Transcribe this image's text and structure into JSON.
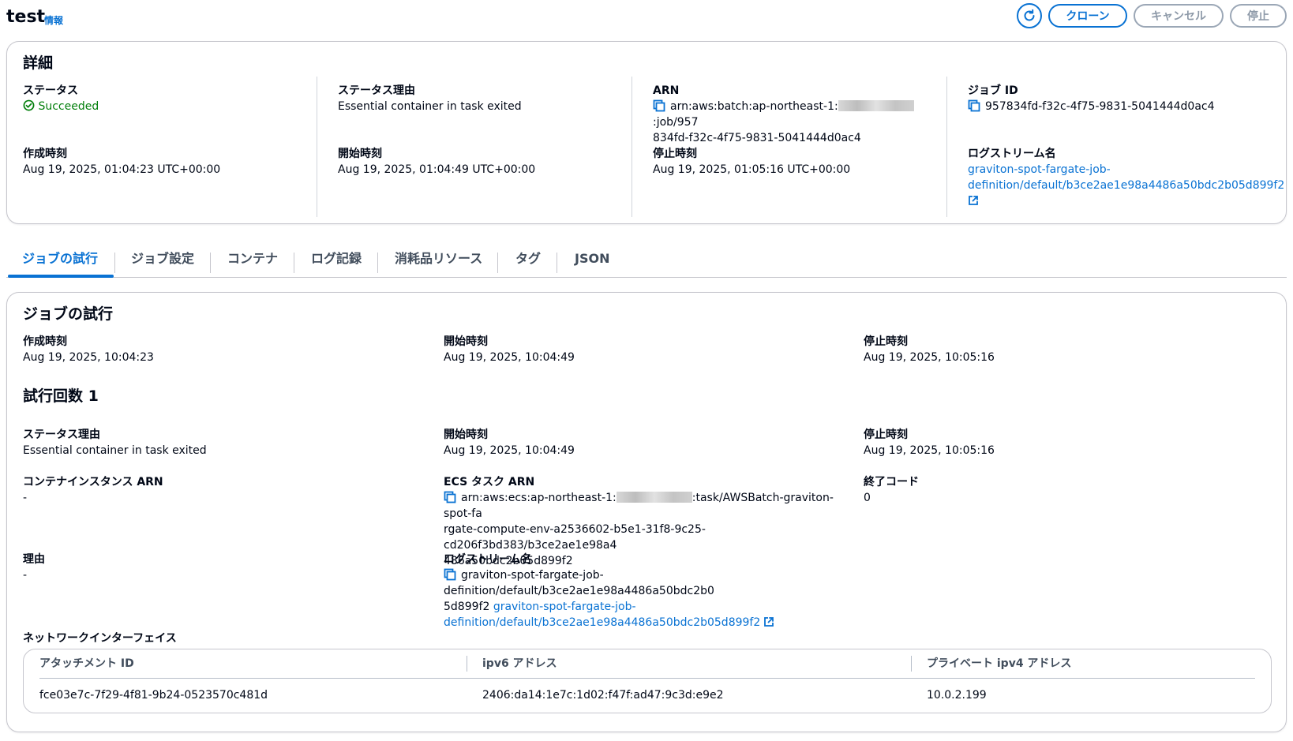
{
  "header": {
    "title": "test",
    "info_link": "情報",
    "buttons": {
      "clone": "クローン",
      "cancel": "キャンセル",
      "stop": "停止"
    }
  },
  "details": {
    "heading": "詳細",
    "status_label": "ステータス",
    "status_value": "Succeeded",
    "status_reason_label": "ステータス理由",
    "status_reason_value": "Essential container in task exited",
    "arn_label": "ARN",
    "arn_prefix": "arn:aws:batch:ap-northeast-1:",
    "arn_suffix_line1": ":job/957",
    "arn_line2": "834fd-f32c-4f75-9831-5041444d0ac4",
    "job_id_label": "ジョブ ID",
    "job_id_value": "957834fd-f32c-4f75-9831-5041444d0ac4",
    "created_label": "作成時刻",
    "created_value": "Aug 19, 2025, 01:04:23 UTC+00:00",
    "started_label": "開始時刻",
    "started_value": "Aug 19, 2025, 01:04:49 UTC+00:00",
    "stopped_label": "停止時刻",
    "stopped_value": "Aug 19, 2025, 01:05:16 UTC+00:00",
    "log_stream_label": "ログストリーム名",
    "log_stream_line1": "graviton-spot-fargate-job-",
    "log_stream_line2": "definition/default/b3ce2ae1e98a4486a50bdc2b05d899f2"
  },
  "tabs": [
    "ジョブの試行",
    "ジョブ設定",
    "コンテナ",
    "ログ記録",
    "消耗品リソース",
    "タグ",
    "JSON"
  ],
  "attempts": {
    "heading": "ジョブの試行",
    "created_label": "作成時刻",
    "created_value": "Aug 19, 2025, 10:04:23",
    "started_label": "開始時刻",
    "started_value": "Aug 19, 2025, 10:04:49",
    "stopped_label": "停止時刻",
    "stopped_value": "Aug 19, 2025, 10:05:16",
    "attempt_heading": "試行回数 1",
    "attempt": {
      "status_reason_label": "ステータス理由",
      "status_reason_value": "Essential container in task exited",
      "started_label": "開始時刻",
      "started_value": "Aug 19, 2025, 10:04:49",
      "stopped_label": "停止時刻",
      "stopped_value": "Aug 19, 2025, 10:05:16",
      "container_instance_arn_label": "コンテナインスタンス ARN",
      "container_instance_arn_value": "-",
      "ecs_task_arn_label": "ECS タスク ARN",
      "ecs_task_arn_prefix": "arn:aws:ecs:ap-northeast-1:",
      "ecs_task_arn_suffix_line1": ":task/AWSBatch-graviton-spot-fa",
      "ecs_task_arn_line2": "rgate-compute-env-a2536602-b5e1-31f8-9c25-cd206f3bd383/b3ce2ae1e98a4",
      "ecs_task_arn_line3": "486a50bdc2b05d899f2",
      "exit_code_label": "終了コード",
      "exit_code_value": "0",
      "reason_label": "理由",
      "reason_value": "-",
      "log_stream_label": "ログストリーム名",
      "log_stream_line1": "graviton-spot-fargate-job-definition/default/b3ce2ae1e98a4486a50bdc2b0",
      "log_stream_line2_text": "5d899f2",
      "log_stream_link_line1": "graviton-spot-fargate-job-",
      "log_stream_link_line2": "definition/default/b3ce2ae1e98a4486a50bdc2b05d899f2",
      "network_label": "ネットワークインターフェイス",
      "network_table": {
        "columns": [
          "アタッチメント ID",
          "ipv6 アドレス",
          "プライベート ipv4 アドレス"
        ],
        "rows": [
          [
            "fce03e7c-7f29-4f81-9b24-0523570c481d",
            "2406:da14:1e7c:1d02:f47f:ad47:9c3d:e9e2",
            "10.0.2.199"
          ]
        ]
      }
    }
  },
  "colors": {
    "link": "#0972d3",
    "success": "#037f0c",
    "border": "#c6c6cd"
  }
}
